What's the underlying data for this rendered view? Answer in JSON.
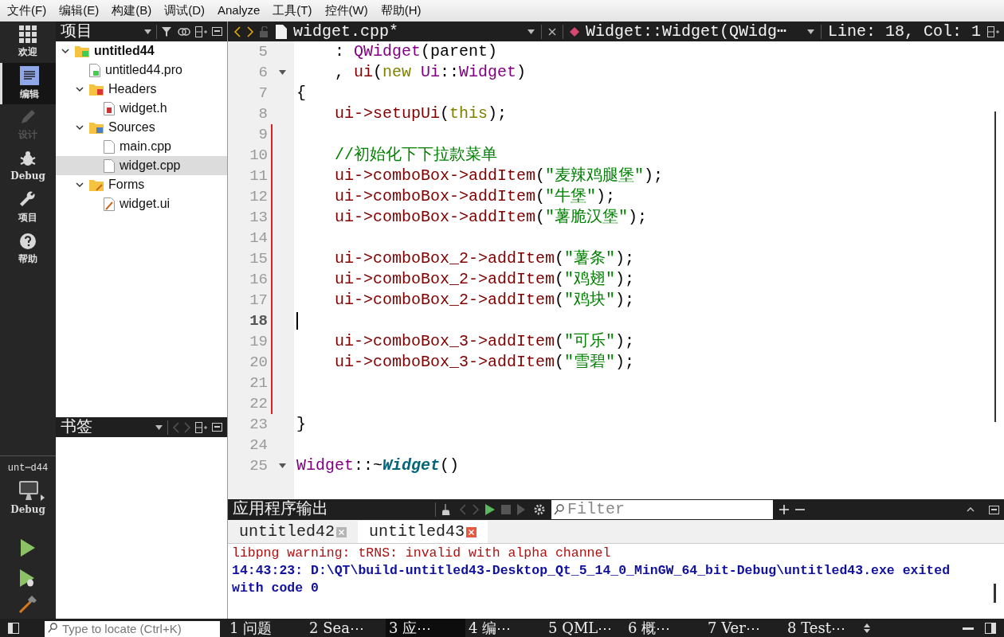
{
  "menu": [
    "文件(F)",
    "编辑(E)",
    "构建(B)",
    "调试(D)",
    "Analyze",
    "工具(T)",
    "控件(W)",
    "帮助(H)"
  ],
  "modes": [
    {
      "label": "欢迎",
      "kind": "welcome",
      "selected": false,
      "disabled": false
    },
    {
      "label": "编辑",
      "kind": "edit",
      "selected": true,
      "disabled": false
    },
    {
      "label": "设计",
      "kind": "design",
      "selected": false,
      "disabled": true
    },
    {
      "label": "Debug",
      "kind": "debug",
      "selected": false,
      "disabled": false
    },
    {
      "label": "项目",
      "kind": "projects",
      "selected": false,
      "disabled": false
    },
    {
      "label": "帮助",
      "kind": "help",
      "selected": false,
      "disabled": false
    }
  ],
  "kit": {
    "project": "unt⋯d44",
    "build": "Debug"
  },
  "project_panel": {
    "title": "项目",
    "tree": [
      {
        "label": "untitled44",
        "kind": "project",
        "expanded": true,
        "selected": false,
        "children": [
          {
            "label": "untitled44.pro",
            "kind": "pro",
            "selected": false
          },
          {
            "label": "Headers",
            "kind": "headers",
            "expanded": true,
            "selected": false,
            "children": [
              {
                "label": "widget.h",
                "kind": "header",
                "selected": false
              }
            ]
          },
          {
            "label": "Sources",
            "kind": "sources",
            "expanded": true,
            "selected": false,
            "children": [
              {
                "label": "main.cpp",
                "kind": "source",
                "selected": false
              },
              {
                "label": "widget.cpp",
                "kind": "source",
                "selected": true
              }
            ]
          },
          {
            "label": "Forms",
            "kind": "forms",
            "expanded": true,
            "selected": false,
            "children": [
              {
                "label": "widget.ui",
                "kind": "form",
                "selected": false
              }
            ]
          }
        ]
      }
    ]
  },
  "bookmarks_panel": {
    "title": "书签"
  },
  "editor": {
    "file": "widget.cpp*",
    "symbol": "Widget::Widget(QWidg⋯",
    "position": "Line: 18, Col: 1",
    "lines": [
      {
        "number": "5",
        "fold": false,
        "changed": false,
        "current": false,
        "tokens": [
          {
            "kind": "plain",
            "text": "    : "
          },
          {
            "kind": "type",
            "text": "QWidget"
          },
          {
            "kind": "plain",
            "text": "(parent)"
          }
        ]
      },
      {
        "number": "6",
        "fold": true,
        "changed": false,
        "current": false,
        "tokens": [
          {
            "kind": "plain",
            "text": "    , "
          },
          {
            "kind": "member",
            "text": "ui"
          },
          {
            "kind": "plain",
            "text": "("
          },
          {
            "kind": "keyword",
            "text": "new"
          },
          {
            "kind": "type",
            "text": " Ui"
          },
          {
            "kind": "plain",
            "text": "::"
          },
          {
            "kind": "type",
            "text": "Widget"
          },
          {
            "kind": "plain",
            "text": ")"
          }
        ]
      },
      {
        "number": "7",
        "fold": false,
        "changed": false,
        "current": false,
        "tokens": [
          {
            "kind": "plain",
            "text": "{"
          }
        ]
      },
      {
        "number": "8",
        "fold": false,
        "changed": false,
        "current": false,
        "tokens": [
          {
            "kind": "member",
            "text": "    ui->setupUi"
          },
          {
            "kind": "plain",
            "text": "("
          },
          {
            "kind": "keyword",
            "text": "this"
          },
          {
            "kind": "plain",
            "text": ");"
          }
        ]
      },
      {
        "number": "9",
        "fold": false,
        "changed": true,
        "current": false
      },
      {
        "number": "10",
        "fold": false,
        "changed": true,
        "current": false,
        "tokens": [
          {
            "kind": "comment",
            "text": "    //初始化下下拉款菜单"
          }
        ]
      },
      {
        "number": "11",
        "fold": false,
        "changed": true,
        "current": false,
        "tokens": [
          {
            "kind": "member",
            "text": "    ui->comboBox->addItem"
          },
          {
            "kind": "plain",
            "text": "("
          },
          {
            "kind": "string",
            "text": "\"麦辣鸡腿堡\""
          },
          {
            "kind": "plain",
            "text": ");"
          }
        ]
      },
      {
        "number": "12",
        "fold": false,
        "changed": true,
        "current": false,
        "tokens": [
          {
            "kind": "member",
            "text": "    ui->comboBox->addItem"
          },
          {
            "kind": "plain",
            "text": "("
          },
          {
            "kind": "string",
            "text": "\"牛堡\""
          },
          {
            "kind": "plain",
            "text": ");"
          }
        ]
      },
      {
        "number": "13",
        "fold": false,
        "changed": true,
        "current": false,
        "tokens": [
          {
            "kind": "member",
            "text": "    ui->comboBox->addItem"
          },
          {
            "kind": "plain",
            "text": "("
          },
          {
            "kind": "string",
            "text": "\"薯脆汉堡\""
          },
          {
            "kind": "plain",
            "text": ");"
          }
        ]
      },
      {
        "number": "14",
        "fold": false,
        "changed": true,
        "current": false
      },
      {
        "number": "15",
        "fold": false,
        "changed": true,
        "current": false,
        "tokens": [
          {
            "kind": "member",
            "text": "    ui->comboBox_2->addItem"
          },
          {
            "kind": "plain",
            "text": "("
          },
          {
            "kind": "string",
            "text": "\"薯条\""
          },
          {
            "kind": "plain",
            "text": ");"
          }
        ]
      },
      {
        "number": "16",
        "fold": false,
        "changed": true,
        "current": false,
        "tokens": [
          {
            "kind": "member",
            "text": "    ui->comboBox_2->addItem"
          },
          {
            "kind": "plain",
            "text": "("
          },
          {
            "kind": "string",
            "text": "\"鸡翅\""
          },
          {
            "kind": "plain",
            "text": ");"
          }
        ]
      },
      {
        "number": "17",
        "fold": false,
        "changed": true,
        "current": false,
        "tokens": [
          {
            "kind": "member",
            "text": "    ui->comboBox_2->addItem"
          },
          {
            "kind": "plain",
            "text": "("
          },
          {
            "kind": "string",
            "text": "\"鸡块\""
          },
          {
            "kind": "plain",
            "text": ");"
          }
        ]
      },
      {
        "number": "18",
        "fold": false,
        "changed": true,
        "current": true
      },
      {
        "number": "19",
        "fold": false,
        "changed": true,
        "current": false,
        "tokens": [
          {
            "kind": "member",
            "text": "    ui->comboBox_3->addItem"
          },
          {
            "kind": "plain",
            "text": "("
          },
          {
            "kind": "string",
            "text": "\"可乐\""
          },
          {
            "kind": "plain",
            "text": ");"
          }
        ]
      },
      {
        "number": "20",
        "fold": false,
        "changed": true,
        "current": false,
        "tokens": [
          {
            "kind": "member",
            "text": "    ui->comboBox_3->addItem"
          },
          {
            "kind": "plain",
            "text": "("
          },
          {
            "kind": "string",
            "text": "\"雪碧\""
          },
          {
            "kind": "plain",
            "text": ");"
          }
        ]
      },
      {
        "number": "21",
        "fold": false,
        "changed": true,
        "current": false
      },
      {
        "number": "22",
        "fold": false,
        "changed": true,
        "current": false
      },
      {
        "number": "23",
        "fold": false,
        "changed": false,
        "current": false,
        "tokens": [
          {
            "kind": "plain",
            "text": "}"
          }
        ]
      },
      {
        "number": "24",
        "fold": false,
        "changed": false,
        "current": false
      },
      {
        "number": "25",
        "fold": true,
        "changed": false,
        "current": false,
        "tokens": [
          {
            "kind": "type",
            "text": "Widget"
          },
          {
            "kind": "plain",
            "text": "::~"
          },
          {
            "kind": "declaration",
            "text": "Widget"
          },
          {
            "kind": "plain",
            "text": "()"
          }
        ]
      }
    ]
  },
  "output": {
    "title": "应用程序输出",
    "filter": {
      "placeholder": "Filter"
    },
    "tabs": [
      {
        "label": "untitled42",
        "selected": false
      },
      {
        "label": "untitled43",
        "selected": true
      }
    ],
    "messages": [
      {
        "kind": "warning",
        "text": "libpng warning: tRNS: invalid with alpha channel"
      },
      {
        "kind": "info",
        "text": "14:43:23: D:\\QT\\build-untitled43-Desktop_Qt_5_14_0_MinGW_64_bit-Debug\\untitled43.exe exited with code 0"
      }
    ]
  },
  "status_bar": {
    "locator": {
      "placeholder": "Type to locate (Ctrl+K)"
    },
    "panes": [
      {
        "label": "1 问题",
        "selected": false
      },
      {
        "label": "2 Sea⋯",
        "selected": false
      },
      {
        "label": "3 应⋯",
        "selected": true
      },
      {
        "label": "4 编⋯",
        "selected": false
      },
      {
        "label": "5 QML⋯",
        "selected": false
      },
      {
        "label": "6 概⋯",
        "selected": false
      },
      {
        "label": "7 Ver⋯",
        "selected": false
      },
      {
        "label": "8 Test⋯",
        "selected": false
      }
    ]
  }
}
